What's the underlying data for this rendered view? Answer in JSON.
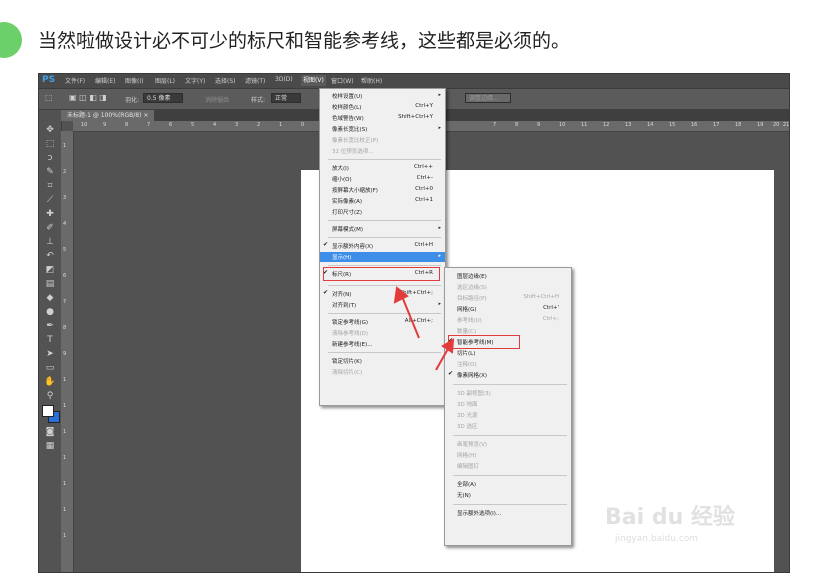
{
  "caption": "当然啦做设计必不可少的标尺和智能参考线，这些都是必须的。",
  "colors": {
    "badge": "#6bd06a",
    "highlight": "#3d8ee8",
    "annotation": "#e23b3b",
    "ps_logo": "#3fa0e8"
  },
  "ps": {
    "logo": "PS",
    "menubar": [
      "文件(F)",
      "编辑(E)",
      "图像(I)",
      "图层(L)",
      "文字(Y)",
      "选择(S)",
      "滤镜(T)",
      "3D(D)",
      "视图(V)",
      "窗口(W)",
      "帮助(H)"
    ],
    "active_menu": "视图(V)",
    "options": {
      "feather_label": "羽化:",
      "feather_value": "0.5 像素",
      "antialias": "消除锯齿",
      "style_label": "样式:",
      "style_value": "正常",
      "refine_edge": "调整边缘..."
    },
    "doc_tab": "未标题-1 @ 100%(RGB/8) ×",
    "ruler_h": [
      "10",
      "9",
      "8",
      "7",
      "6",
      "5",
      "4",
      "3",
      "2",
      "1",
      "0",
      "7",
      "8",
      "9",
      "10",
      "11",
      "12",
      "13",
      "14",
      "15",
      "16",
      "17",
      "18",
      "19",
      "20",
      "21"
    ],
    "ruler_v": [
      "1",
      "2",
      "3",
      "4",
      "5",
      "6",
      "7",
      "8",
      "9",
      "1",
      "1",
      "1",
      "1",
      "1",
      "1",
      "1"
    ],
    "tool_icons": [
      "move-icon",
      "marquee-icon",
      "lasso-icon",
      "quick-select-icon",
      "crop-icon",
      "eyedropper-icon",
      "healing-icon",
      "brush-icon",
      "stamp-icon",
      "history-brush-icon",
      "eraser-icon",
      "gradient-icon",
      "blur-icon",
      "dodge-icon",
      "pen-icon",
      "type-icon",
      "path-select-icon",
      "shape-icon",
      "hand-icon",
      "zoom-icon"
    ]
  },
  "view_menu": [
    {
      "label": "校样设置(U)",
      "arrow": true
    },
    {
      "label": "校样颜色(L)",
      "shortcut": "Ctrl+Y"
    },
    {
      "label": "色域警告(W)",
      "shortcut": "Shift+Ctrl+Y"
    },
    {
      "label": "像素长宽比(S)",
      "arrow": true
    },
    {
      "label": "像素长宽比校正(P)",
      "disabled": true
    },
    {
      "label": "32 位预览选项...",
      "disabled": true
    },
    {
      "label": "放大(I)",
      "shortcut": "Ctrl++"
    },
    {
      "label": "缩小(O)",
      "shortcut": "Ctrl+-"
    },
    {
      "label": "按屏幕大小缩放(F)",
      "shortcut": "Ctrl+0"
    },
    {
      "label": "实际像素(A)",
      "shortcut": "Ctrl+1"
    },
    {
      "label": "打印尺寸(Z)"
    },
    {
      "label": "屏幕模式(M)",
      "arrow": true
    },
    {
      "label": "显示额外内容(X)",
      "shortcut": "Ctrl+H",
      "check": true
    },
    {
      "label": "显示(H)",
      "arrow": true,
      "highlight": true
    },
    {
      "label": "标尺(R)",
      "shortcut": "Ctrl+R",
      "check": true
    },
    {
      "label": "对齐(N)",
      "shortcut": "Shift+Ctrl+;",
      "check": true
    },
    {
      "label": "对齐到(T)",
      "arrow": true
    },
    {
      "label": "锁定参考线(G)",
      "shortcut": "Alt+Ctrl+;"
    },
    {
      "label": "清除参考线(D)",
      "disabled": true
    },
    {
      "label": "新建参考线(E)..."
    },
    {
      "label": "锁定切片(K)"
    },
    {
      "label": "清除切片(C)",
      "disabled": true
    }
  ],
  "show_submenu": [
    {
      "label": "图层边缘(E)"
    },
    {
      "label": "选区边缘(S)",
      "disabled": true
    },
    {
      "label": "目标路径(P)",
      "shortcut": "Shift+Ctrl+H",
      "disabled": true
    },
    {
      "label": "网格(G)",
      "shortcut": "Ctrl+'"
    },
    {
      "label": "参考线(U)",
      "shortcut": "Ctrl+;",
      "disabled": true
    },
    {
      "label": "数量(C)",
      "disabled": true
    },
    {
      "label": "智能参考线(M)",
      "check": true
    },
    {
      "label": "切片(L)"
    },
    {
      "label": "注释(O)",
      "disabled": true
    },
    {
      "label": "像素网格(X)",
      "check": true
    },
    {
      "label": "3D 副视图(3)",
      "disabled": true
    },
    {
      "label": "3D 地面",
      "disabled": true
    },
    {
      "label": "3D 光源",
      "disabled": true
    },
    {
      "label": "3D 选区",
      "disabled": true
    },
    {
      "label": "画笔预览(V)",
      "disabled": true
    },
    {
      "label": "网格(H)",
      "disabled": true
    },
    {
      "label": "编辑图钉",
      "disabled": true
    },
    {
      "label": "全部(A)"
    },
    {
      "label": "无(N)"
    },
    {
      "label": "显示额外选项(I)..."
    }
  ],
  "watermark": {
    "main": "Bai du 经验",
    "sub": "jingyan.baidu.com"
  }
}
